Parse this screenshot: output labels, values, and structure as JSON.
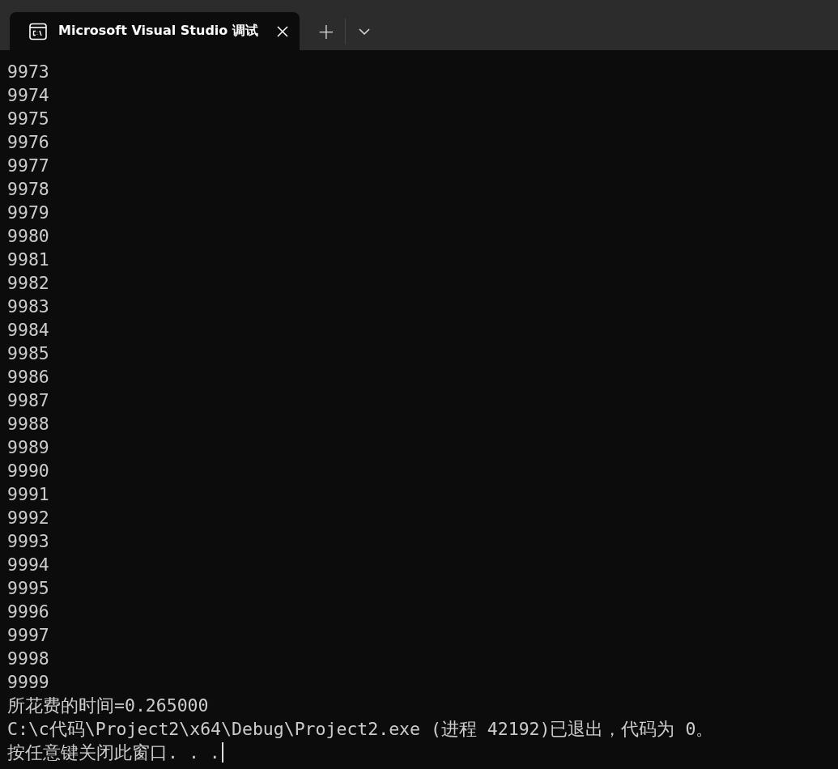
{
  "tab_bar": {
    "tabs": [
      {
        "title": "Microsoft Visual Studio 调试",
        "selected": true
      }
    ],
    "new_tab": "+"
  },
  "console": {
    "lines": [
      "9973",
      "9974",
      "9975",
      "9976",
      "9977",
      "9978",
      "9979",
      "9980",
      "9981",
      "9982",
      "9983",
      "9984",
      "9985",
      "9986",
      "9987",
      "9988",
      "9989",
      "9990",
      "9991",
      "9992",
      "9993",
      "9994",
      "9995",
      "9996",
      "9997",
      "9998",
      "9999",
      "所花费的时间=0.265000",
      "C:\\c代码\\Project2\\x64\\Debug\\Project2.exe (进程 42192)已退出，代码为 0。",
      "按任意键关闭此窗口. . ."
    ],
    "cursor_visible": true
  }
}
